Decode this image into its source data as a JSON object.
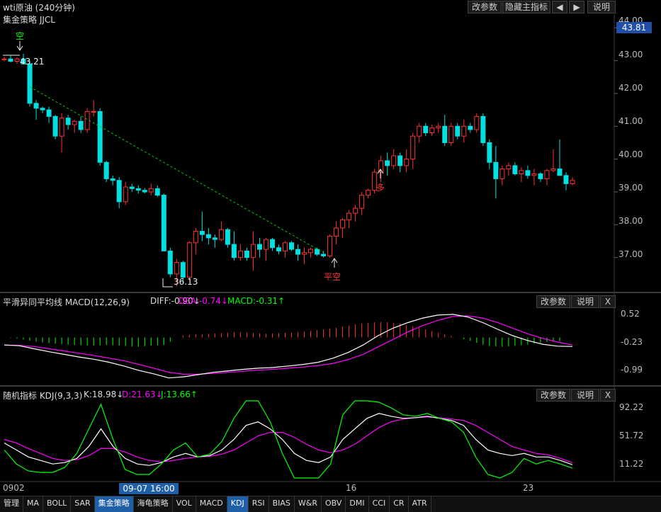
{
  "window": {
    "title": "wti原油 (240分钟)",
    "buttons": [
      "改参数",
      "隐藏主指标",
      "◀",
      "▶",
      "说明"
    ]
  },
  "main": {
    "indicator_label": "集金策略 JJCL",
    "last_price": "43.81",
    "high_annot": "43.21",
    "low_annot": "36.13",
    "signals": {
      "short": "空",
      "long": "多",
      "cover": "平空"
    },
    "y_ticks": [
      "44.00",
      "43.00",
      "42.00",
      "41.00",
      "40.00",
      "39.00",
      "38.00",
      "37.00"
    ]
  },
  "macd": {
    "title": "平滑异同平均线 MACD(12,26,9)",
    "diff": "DIFF:-0.90↓",
    "dea": "DEA:-0.74↓",
    "macd": "MACD:-0.31↑",
    "buttons": [
      "改参数",
      "说明",
      "X"
    ],
    "y_ticks": [
      "0.52",
      "-0.23",
      "-0.99"
    ]
  },
  "kdj": {
    "title": "随机指标 KDJ(9,3,3)",
    "k": "K:18.98↓",
    "d": "D:21.63↓",
    "j": "J:13.66↑",
    "buttons": [
      "改参数",
      "说明",
      "X"
    ],
    "y_ticks": [
      "92.22",
      "51.72",
      "11.22"
    ]
  },
  "x_axis": {
    "labels": [
      "0902",
      "16",
      "23"
    ],
    "cursor_label": "09-07 16:00"
  },
  "tabs": [
    "管理",
    "MA",
    "BOLL",
    "SAR",
    "集金策略",
    "海龟策略",
    "VOL",
    "MACD",
    "KDJ",
    "RSI",
    "BIAS",
    "W&R",
    "OBV",
    "DMI",
    "CCI",
    "CR",
    "ATR"
  ],
  "active_tabs": [
    "集金策略",
    "KDJ"
  ],
  "colors": {
    "up": "#ff3232",
    "down": "#00e0e0",
    "diff": "#ffffff",
    "dea": "#ff00ff",
    "j": "#00ff00",
    "trend": "#00cc00",
    "grid": "#3a2a20"
  },
  "chart_data": [
    {
      "type": "candlestick",
      "title": "wti原油 (240分钟)",
      "ylim": [
        36.0,
        44.2
      ],
      "candles": [
        [
          43.05,
          43.12,
          42.98,
          43.05
        ],
        [
          43.05,
          43.15,
          42.95,
          42.98
        ],
        [
          42.98,
          43.1,
          42.9,
          43.05
        ],
        [
          43.05,
          43.21,
          42.95,
          42.9
        ],
        [
          42.9,
          43.0,
          41.6,
          41.7
        ],
        [
          41.7,
          41.8,
          41.2,
          41.55
        ],
        [
          41.55,
          41.6,
          41.4,
          41.5
        ],
        [
          41.5,
          41.6,
          41.1,
          41.3
        ],
        [
          41.3,
          41.35,
          40.6,
          40.7
        ],
        [
          40.7,
          41.4,
          40.2,
          41.25
        ],
        [
          41.25,
          41.35,
          40.9,
          41.05
        ],
        [
          41.05,
          41.2,
          40.8,
          41.15
        ],
        [
          41.15,
          41.3,
          40.8,
          40.9
        ],
        [
          40.9,
          41.55,
          40.8,
          41.45
        ],
        [
          41.45,
          41.8,
          41.3,
          41.45
        ],
        [
          41.45,
          41.55,
          39.8,
          39.9
        ],
        [
          39.9,
          39.95,
          39.3,
          39.4
        ],
        [
          39.4,
          39.5,
          39.2,
          39.35
        ],
        [
          39.35,
          39.45,
          38.5,
          38.7
        ],
        [
          38.7,
          39.3,
          38.6,
          39.15
        ],
        [
          39.15,
          39.25,
          39.0,
          39.1
        ],
        [
          39.1,
          39.2,
          38.95,
          39.05
        ],
        [
          39.05,
          39.12,
          38.95,
          39.0
        ],
        [
          39.0,
          39.25,
          38.9,
          39.1
        ],
        [
          39.1,
          39.2,
          38.85,
          38.9
        ],
        [
          38.9,
          38.95,
          37.2,
          37.2
        ],
        [
          37.2,
          37.3,
          36.4,
          36.5
        ],
        [
          36.5,
          36.95,
          36.13,
          36.85
        ],
        [
          36.85,
          36.9,
          36.2,
          36.4
        ],
        [
          36.4,
          37.5,
          36.3,
          37.45
        ],
        [
          37.45,
          37.9,
          37.1,
          37.8
        ],
        [
          37.8,
          38.4,
          37.5,
          37.7
        ],
        [
          37.7,
          37.9,
          37.4,
          37.6
        ],
        [
          37.6,
          37.7,
          37.3,
          37.55
        ],
        [
          37.55,
          38.1,
          37.5,
          37.85
        ],
        [
          37.85,
          37.9,
          37.3,
          37.4
        ],
        [
          37.4,
          37.8,
          36.9,
          37.0
        ],
        [
          37.0,
          37.4,
          36.9,
          37.2
        ],
        [
          37.2,
          37.3,
          36.9,
          37.0
        ],
        [
          37.0,
          37.8,
          36.6,
          37.4
        ],
        [
          37.4,
          37.6,
          37.0,
          37.25
        ],
        [
          37.25,
          37.6,
          36.9,
          37.55
        ],
        [
          37.55,
          37.6,
          37.2,
          37.3
        ],
        [
          37.3,
          37.4,
          37.1,
          37.2
        ],
        [
          37.2,
          37.5,
          37.0,
          37.45
        ],
        [
          37.45,
          37.5,
          37.2,
          37.25
        ],
        [
          37.25,
          37.4,
          36.9,
          37.1
        ],
        [
          37.1,
          37.3,
          36.8,
          37.15
        ],
        [
          37.15,
          37.3,
          37.0,
          37.25
        ],
        [
          37.25,
          37.3,
          37.05,
          37.1
        ],
        [
          37.1,
          37.2,
          37.0,
          37.05
        ],
        [
          37.05,
          37.7,
          37.0,
          37.65
        ],
        [
          37.65,
          38.1,
          37.4,
          37.9
        ],
        [
          37.9,
          38.2,
          37.6,
          38.15
        ],
        [
          38.15,
          38.45,
          37.9,
          38.35
        ],
        [
          38.35,
          38.6,
          38.1,
          38.5
        ],
        [
          38.5,
          39.0,
          38.3,
          38.9
        ],
        [
          38.9,
          39.1,
          38.8,
          39.05
        ],
        [
          39.05,
          39.7,
          38.95,
          39.6
        ],
        [
          39.6,
          40.1,
          39.3,
          39.95
        ],
        [
          39.95,
          40.2,
          39.5,
          39.8
        ],
        [
          39.8,
          40.3,
          39.7,
          40.1
        ],
        [
          40.1,
          40.2,
          39.6,
          39.8
        ],
        [
          39.8,
          40.3,
          39.6,
          40.0
        ],
        [
          40.0,
          40.8,
          39.7,
          40.7
        ],
        [
          40.7,
          41.1,
          40.5,
          41.0
        ],
        [
          41.0,
          41.1,
          40.7,
          40.8
        ],
        [
          40.8,
          41.05,
          40.7,
          40.95
        ],
        [
          40.95,
          41.1,
          40.8,
          41.0
        ],
        [
          41.0,
          41.35,
          40.4,
          40.5
        ],
        [
          40.5,
          41.1,
          40.4,
          41.0
        ],
        [
          41.0,
          41.1,
          40.6,
          40.7
        ],
        [
          40.7,
          41.2,
          40.5,
          41.0
        ],
        [
          41.0,
          41.1,
          40.8,
          40.9
        ],
        [
          40.9,
          41.4,
          40.8,
          41.3
        ],
        [
          41.3,
          41.4,
          40.4,
          40.5
        ],
        [
          40.5,
          40.6,
          39.7,
          39.9
        ],
        [
          39.9,
          40.4,
          38.8,
          39.4
        ],
        [
          39.4,
          39.8,
          39.2,
          39.7
        ],
        [
          39.7,
          39.9,
          39.5,
          39.8
        ],
        [
          39.8,
          39.9,
          39.5,
          39.55
        ],
        [
          39.55,
          39.75,
          39.3,
          39.65
        ],
        [
          39.65,
          39.8,
          39.4,
          39.5
        ],
        [
          39.5,
          39.7,
          39.2,
          39.55
        ],
        [
          39.55,
          39.6,
          39.3,
          39.4
        ],
        [
          39.4,
          39.7,
          39.2,
          39.65
        ],
        [
          39.65,
          40.3,
          39.6,
          39.7
        ],
        [
          39.7,
          40.6,
          39.6,
          39.5
        ],
        [
          39.5,
          39.6,
          39.05,
          39.25
        ],
        [
          39.25,
          39.45,
          39.2,
          39.35
        ]
      ]
    },
    {
      "type": "line",
      "title": "平滑异同平均线 MACD(12,26,9)",
      "ylim": [
        -1.2,
        0.75
      ],
      "series": [
        {
          "name": "DIFF",
          "values": [
            -0.2,
            -0.22,
            -0.3,
            -0.38,
            -0.45,
            -0.52,
            -0.58,
            -0.66,
            -0.76,
            -0.88,
            -0.97,
            -1.08,
            -1.05,
            -0.99,
            -0.93,
            -0.89,
            -0.85,
            -0.82,
            -0.8,
            -0.76,
            -0.72,
            -0.66,
            -0.55,
            -0.4,
            -0.2,
            0.05,
            0.25,
            0.4,
            0.52,
            0.6,
            0.62,
            0.55,
            0.4,
            0.22,
            0.05,
            -0.08,
            -0.18,
            -0.23,
            -0.24
          ]
        },
        {
          "name": "DEA",
          "values": [
            -0.2,
            -0.21,
            -0.24,
            -0.3,
            -0.36,
            -0.42,
            -0.48,
            -0.55,
            -0.62,
            -0.72,
            -0.82,
            -0.93,
            -0.98,
            -0.98,
            -0.96,
            -0.93,
            -0.9,
            -0.87,
            -0.85,
            -0.82,
            -0.79,
            -0.75,
            -0.69,
            -0.59,
            -0.45,
            -0.25,
            -0.05,
            0.15,
            0.32,
            0.46,
            0.56,
            0.58,
            0.52,
            0.4,
            0.25,
            0.1,
            -0.02,
            -0.12,
            -0.2
          ]
        },
        {
          "name": "MACD",
          "values": [
            0,
            -0.03,
            -0.1,
            -0.15,
            -0.18,
            -0.2,
            -0.22,
            -0.2,
            -0.22,
            -0.25,
            -0.22,
            -0.2,
            0.05,
            0.08,
            0.1,
            0.12,
            0.15,
            0.12,
            0.1,
            0.12,
            0.14,
            0.18,
            0.22,
            0.28,
            0.35,
            0.4,
            0.42,
            0.38,
            0.3,
            0.2,
            0.1,
            0,
            -0.1,
            -0.22,
            -0.25,
            -0.22,
            -0.18,
            -0.12,
            -0.1
          ]
        }
      ]
    },
    {
      "type": "line",
      "title": "随机指标 KDJ(9,3,3)",
      "ylim": [
        0,
        110
      ],
      "series": [
        {
          "name": "K",
          "values": [
            50,
            40,
            30,
            25,
            20,
            22,
            28,
            45,
            70,
            45,
            28,
            20,
            18,
            22,
            30,
            35,
            30,
            32,
            40,
            55,
            75,
            80,
            70,
            55,
            35,
            25,
            22,
            30,
            55,
            70,
            85,
            92,
            88,
            85,
            86,
            88,
            85,
            82,
            75,
            55,
            40,
            35,
            32,
            35,
            30,
            30,
            25,
            19
          ]
        },
        {
          "name": "D",
          "values": [
            55,
            50,
            42,
            35,
            28,
            25,
            26,
            32,
            42,
            42,
            37,
            30,
            25,
            23,
            25,
            28,
            30,
            31,
            34,
            40,
            50,
            60,
            65,
            65,
            58,
            48,
            40,
            36,
            40,
            48,
            60,
            72,
            80,
            84,
            86,
            87,
            86,
            84,
            82,
            75,
            65,
            55,
            45,
            40,
            35,
            33,
            28,
            22
          ]
        },
        {
          "name": "J",
          "values": [
            40,
            20,
            10,
            8,
            8,
            15,
            35,
            70,
            105,
            55,
            12,
            5,
            5,
            20,
            40,
            50,
            30,
            34,
            52,
            85,
            110,
            110,
            80,
            35,
            0,
            0,
            0,
            20,
            90,
            110,
            110,
            108,
            100,
            90,
            88,
            92,
            85,
            80,
            65,
            30,
            5,
            0,
            8,
            28,
            20,
            25,
            20,
            14
          ]
        }
      ]
    }
  ]
}
